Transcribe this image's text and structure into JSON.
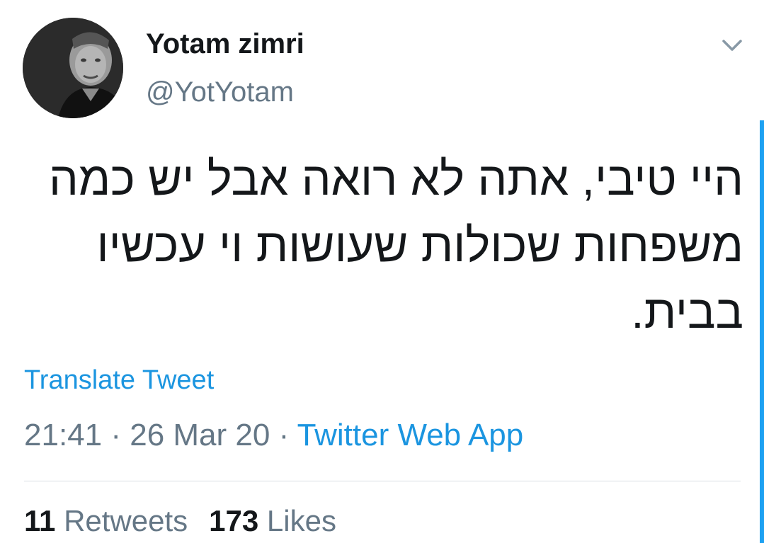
{
  "author": {
    "display_name": "Yotam zimri",
    "handle": "@YotYotam"
  },
  "tweet": {
    "lines": [
      "היי טיבי, אתה לא רואה אבל יש כמה",
      "משפחות שכולות שעושות וי עכשיו",
      "בבית."
    ],
    "translate_label": "Translate Tweet",
    "time": "21:41",
    "date": "26 Mar 20",
    "separator": "·",
    "source": "Twitter Web App"
  },
  "stats": {
    "retweets_count": "11",
    "retweets_label": "Retweets",
    "likes_count": "173",
    "likes_label": "Likes"
  },
  "icons": {
    "caret": "chevron-down-icon"
  },
  "colors": {
    "link": "#1b95e0",
    "muted": "#657786",
    "text": "#14171a",
    "accent": "#1da1f2"
  }
}
